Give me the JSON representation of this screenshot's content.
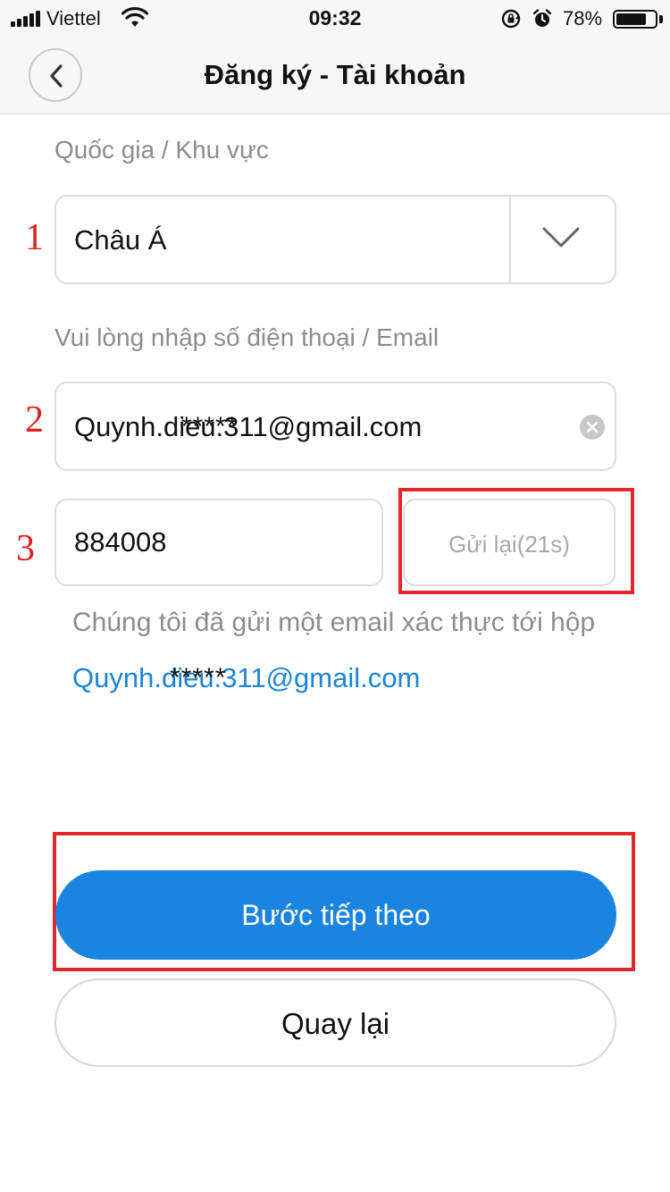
{
  "status_bar": {
    "carrier": "Viettel",
    "time": "09:32",
    "battery": "78%",
    "battery_level": 0.78
  },
  "nav": {
    "title": "Đăng ký - Tài khoản",
    "back_icon": "chevron-left-icon"
  },
  "form": {
    "region_label": "Quốc gia / Khu vực",
    "region_value": "Châu Á",
    "contact_label": "Vui lòng nhập số điện thoại / Email",
    "email_value": "Quynh.dieu.311@gmail.com",
    "email_mask": "*****",
    "code_value": "884008",
    "resend_label": "Gửi lại(21s)"
  },
  "info": {
    "message": "Chúng tôi đã gửi một email xác thực tới hộp",
    "email": "Quynh.dieu.311@gmail.com",
    "email_mask": "*****"
  },
  "actions": {
    "next_label": "Bước tiếp theo",
    "back_label": "Quay lại"
  },
  "annotations": {
    "step1": "1",
    "step2": "2",
    "step3": "3"
  },
  "colors": {
    "primary": "#1b84e0",
    "link": "#1b84d8",
    "annotation_red": "#e3262d"
  }
}
